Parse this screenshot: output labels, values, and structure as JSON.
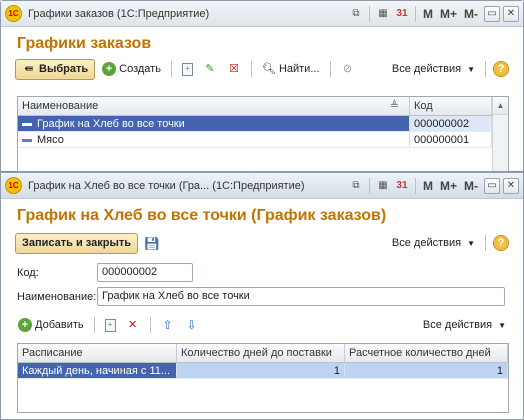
{
  "win1": {
    "title": "Графики заказов  (1С:Предприятие)",
    "form_title": "Графики заказов",
    "select_label": "Выбрать",
    "create_label": "Создать",
    "find_label": "Найти...",
    "all_actions": "Все действия",
    "columns": [
      "Наименование",
      "Код"
    ],
    "rows": [
      {
        "name": "График на Хлеб во все точки",
        "code": "000000002"
      },
      {
        "name": "Мясо",
        "code": "000000001"
      }
    ]
  },
  "win2": {
    "title": "График на Хлеб во все точки (Гра...  (1С:Предприятие)",
    "form_title": "График на Хлеб во все точки (График заказов)",
    "save_close_label": "Записать и закрыть",
    "all_actions": "Все действия",
    "code_label": "Код:",
    "code_value": "000000002",
    "name_label": "Наименование:",
    "name_value": "График на Хлеб во все точки",
    "add_label": "Добавить",
    "table_actions": "Все действия",
    "columns": [
      "Расписание",
      "Количество дней до поставки",
      "Расчетное количество дней"
    ],
    "rows": [
      {
        "schedule": "Каждый день, начиная с 11...",
        "days": "1",
        "calc": "1"
      }
    ]
  },
  "titlebar_tools": {
    "m": "M",
    "mplus": "M+",
    "mminus": "M-",
    "calendar_day": "31"
  },
  "icons": {
    "logo": "1С",
    "help": "?"
  },
  "colors": {
    "accent_orange": "#c17500",
    "selection_blue": "#4464b0"
  }
}
